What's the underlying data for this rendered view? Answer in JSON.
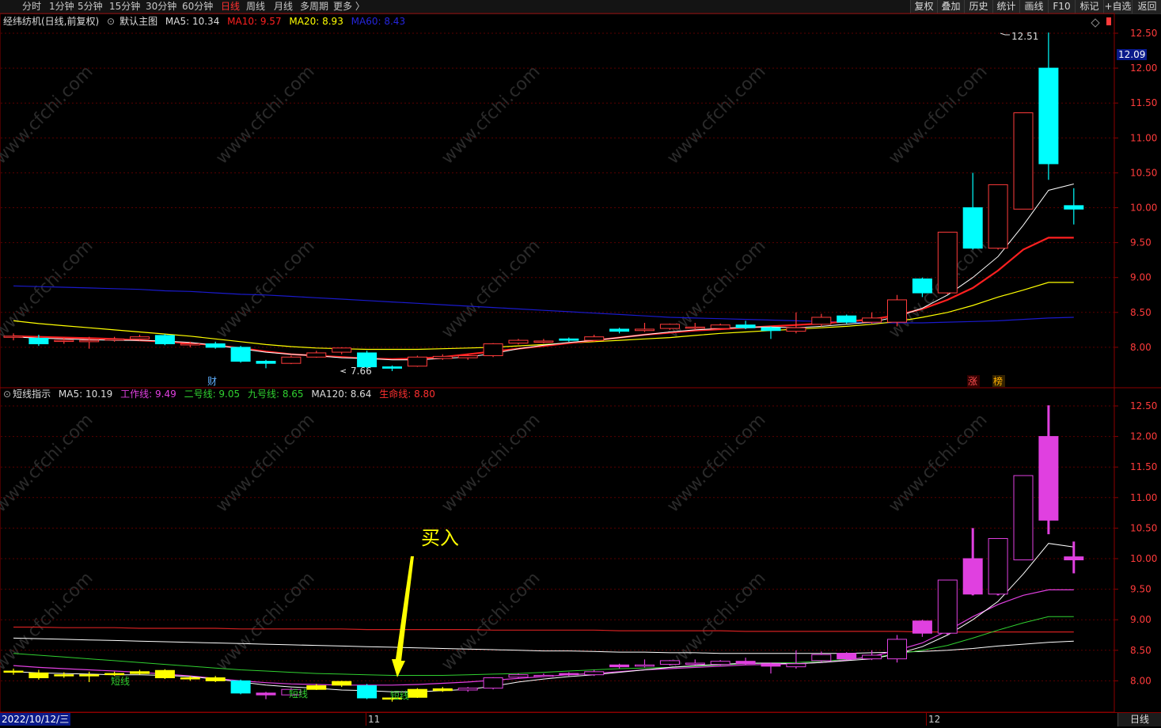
{
  "toolbar": {
    "periods": [
      "分时",
      "1分钟",
      "5分钟",
      "15分钟",
      "30分钟",
      "60分钟",
      "日线",
      "周线",
      "月线",
      "多周期",
      "更多 〉"
    ],
    "active_period": "日线",
    "buttons": [
      "复权",
      "叠加",
      "历史",
      "统计",
      "画线",
      "F10",
      "标记",
      "+自选",
      "返回"
    ]
  },
  "main_legend": {
    "stock": "经纬纺机(日线,前复权)",
    "template": "默认主图",
    "ma5": "MA5: 10.34",
    "ma10": "MA10: 9.57",
    "ma20": "MA20: 8.93",
    "ma60": "MA60: 8.43"
  },
  "sub_legend": {
    "indicator": "短线指示",
    "ma5": "MA5: 10.19",
    "work": "工作线: 9.49",
    "line2": "二号线: 9.05",
    "line9": "九号线: 8.65",
    "ma120": "MA120: 8.64",
    "life": "生命线: 8.80"
  },
  "price_axis": [
    "12.50",
    "12.00",
    "11.50",
    "11.00",
    "10.50",
    "10.00",
    "9.50",
    "9.00",
    "8.50",
    "8.00"
  ],
  "last_price": "12.09",
  "annotations": {
    "high": "12.51",
    "low": "7.66",
    "cai": "财",
    "zhang": "涨",
    "bang": "榜",
    "buy": "买入",
    "short_line": "短线"
  },
  "date_label": "2022/10/12/三",
  "month_ticks": [
    "11",
    "12"
  ],
  "period_button": "日线",
  "watermark": "www.cfchi.com",
  "colors": {
    "up": "#ff3b3b",
    "down": "#00ffff",
    "ma5": "#ffffff",
    "ma10": "#ff2020",
    "ma20": "#ffff00",
    "ma60": "#1a1acc",
    "work": "#e040e0",
    "line2": "#30d030",
    "line9": "#ffffff",
    "life": "#d02020",
    "buy_yellow": "#ffff00",
    "sub_up": "#e040e0"
  },
  "chart_data": [
    {
      "type": "candlestick",
      "title": "经纬纺机(日线,前复权)",
      "ylim": [
        7.5,
        12.6
      ],
      "candles": [
        {
          "o": 8.15,
          "c": 8.16,
          "h": 8.2,
          "l": 8.1
        },
        {
          "o": 8.13,
          "c": 8.05,
          "h": 8.18,
          "l": 8.02
        },
        {
          "o": 8.1,
          "c": 8.1,
          "h": 8.14,
          "l": 8.05
        },
        {
          "o": 8.08,
          "c": 8.1,
          "h": 8.15,
          "l": 7.98
        },
        {
          "o": 8.12,
          "c": 8.12,
          "h": 8.15,
          "l": 8.08
        },
        {
          "o": 8.12,
          "c": 8.15,
          "h": 8.18,
          "l": 8.1
        },
        {
          "o": 8.17,
          "c": 8.05,
          "h": 8.19,
          "l": 8.03
        },
        {
          "o": 8.05,
          "c": 8.05,
          "h": 8.08,
          "l": 8.0
        },
        {
          "o": 8.05,
          "c": 8.0,
          "h": 8.08,
          "l": 7.98
        },
        {
          "o": 8.0,
          "c": 7.8,
          "h": 8.02,
          "l": 7.78
        },
        {
          "o": 7.8,
          "c": 7.77,
          "h": 7.82,
          "l": 7.7
        },
        {
          "o": 7.77,
          "c": 7.86,
          "h": 7.88,
          "l": 7.76
        },
        {
          "o": 7.86,
          "c": 7.92,
          "h": 7.95,
          "l": 7.85
        },
        {
          "o": 7.93,
          "c": 7.99,
          "h": 8.0,
          "l": 7.9
        },
        {
          "o": 7.92,
          "c": 7.72,
          "h": 7.95,
          "l": 7.7
        },
        {
          "o": 7.72,
          "c": 7.7,
          "h": 7.74,
          "l": 7.66
        },
        {
          "o": 7.73,
          "c": 7.86,
          "h": 7.88,
          "l": 7.72
        },
        {
          "o": 7.84,
          "c": 7.87,
          "h": 7.9,
          "l": 7.82
        },
        {
          "o": 7.85,
          "c": 7.88,
          "h": 7.9,
          "l": 7.82
        },
        {
          "o": 7.88,
          "c": 8.05,
          "h": 8.06,
          "l": 7.86
        },
        {
          "o": 8.06,
          "c": 8.1,
          "h": 8.12,
          "l": 8.04
        },
        {
          "o": 8.08,
          "c": 8.09,
          "h": 8.12,
          "l": 8.06
        },
        {
          "o": 8.12,
          "c": 8.1,
          "h": 8.14,
          "l": 8.08
        },
        {
          "o": 8.1,
          "c": 8.15,
          "h": 8.18,
          "l": 8.08
        },
        {
          "o": 8.26,
          "c": 8.23,
          "h": 8.28,
          "l": 8.2
        },
        {
          "o": 8.24,
          "c": 8.26,
          "h": 8.35,
          "l": 8.22
        },
        {
          "o": 8.27,
          "c": 8.33,
          "h": 8.34,
          "l": 8.25
        },
        {
          "o": 8.28,
          "c": 8.29,
          "h": 8.35,
          "l": 8.25
        },
        {
          "o": 8.27,
          "c": 8.32,
          "h": 8.34,
          "l": 8.25
        },
        {
          "o": 8.32,
          "c": 8.28,
          "h": 8.38,
          "l": 8.26
        },
        {
          "o": 8.28,
          "c": 8.24,
          "h": 8.3,
          "l": 8.12
        },
        {
          "o": 8.23,
          "c": 8.28,
          "h": 8.5,
          "l": 8.2
        },
        {
          "o": 8.33,
          "c": 8.43,
          "h": 8.48,
          "l": 8.3
        },
        {
          "o": 8.45,
          "c": 8.36,
          "h": 8.47,
          "l": 8.34
        },
        {
          "o": 8.36,
          "c": 8.42,
          "h": 8.5,
          "l": 8.34
        },
        {
          "o": 8.36,
          "c": 8.68,
          "h": 8.75,
          "l": 8.3
        },
        {
          "o": 8.98,
          "c": 8.78,
          "h": 9.0,
          "l": 8.72
        },
        {
          "o": 8.78,
          "c": 9.65,
          "h": 9.65,
          "l": 8.76
        },
        {
          "o": 10.0,
          "c": 9.42,
          "h": 10.5,
          "l": 9.4
        },
        {
          "o": 9.42,
          "c": 10.33,
          "h": 10.33,
          "l": 9.4
        },
        {
          "o": 9.98,
          "c": 11.36,
          "h": 11.36,
          "l": 9.98
        },
        {
          "o": 12.0,
          "c": 10.63,
          "h": 12.51,
          "l": 10.4
        },
        {
          "o": 10.03,
          "c": 9.98,
          "h": 10.28,
          "l": 9.76
        }
      ],
      "ma5": [
        8.15,
        8.13,
        8.12,
        8.11,
        8.1,
        8.1,
        8.09,
        8.07,
        8.03,
        7.98,
        7.93,
        7.9,
        7.88,
        7.85,
        7.84,
        7.82,
        7.82,
        7.84,
        7.86,
        7.91,
        7.98,
        8.03,
        8.07,
        8.1,
        8.14,
        8.18,
        8.22,
        8.25,
        8.27,
        8.29,
        8.29,
        8.28,
        8.3,
        8.33,
        8.36,
        8.44,
        8.56,
        8.75,
        9.0,
        9.3,
        9.75,
        10.25,
        10.34
      ],
      "ma10": [
        8.16,
        8.15,
        8.14,
        8.13,
        8.12,
        8.1,
        8.08,
        8.06,
        8.03,
        7.99,
        7.94,
        7.9,
        7.88,
        7.86,
        7.84,
        7.83,
        7.84,
        7.86,
        7.9,
        7.94,
        7.98,
        8.02,
        8.06,
        8.1,
        8.14,
        8.18,
        8.21,
        8.24,
        8.26,
        8.28,
        8.3,
        8.32,
        8.34,
        8.37,
        8.4,
        8.46,
        8.55,
        8.68,
        8.85,
        9.1,
        9.4,
        9.57,
        9.57
      ],
      "ma20": [
        8.38,
        8.34,
        8.31,
        8.28,
        8.25,
        8.22,
        8.19,
        8.16,
        8.12,
        8.08,
        8.04,
        8.01,
        7.99,
        7.98,
        7.97,
        7.97,
        7.97,
        7.98,
        7.99,
        8.0,
        8.02,
        8.04,
        8.06,
        8.08,
        8.1,
        8.12,
        8.14,
        8.17,
        8.2,
        8.22,
        8.24,
        8.26,
        8.28,
        8.3,
        8.33,
        8.37,
        8.43,
        8.5,
        8.6,
        8.72,
        8.82,
        8.93,
        8.93
      ],
      "ma60": [
        8.88,
        8.87,
        8.86,
        8.85,
        8.84,
        8.83,
        8.81,
        8.8,
        8.78,
        8.76,
        8.75,
        8.73,
        8.71,
        8.69,
        8.67,
        8.65,
        8.63,
        8.61,
        8.59,
        8.57,
        8.55,
        8.53,
        8.51,
        8.49,
        8.47,
        8.45,
        8.43,
        8.42,
        8.41,
        8.4,
        8.39,
        8.38,
        8.37,
        8.36,
        8.35,
        8.35,
        8.35,
        8.36,
        8.37,
        8.38,
        8.4,
        8.42,
        8.43
      ]
    },
    {
      "type": "candlestick",
      "title": "短线指示",
      "ylim": [
        7.5,
        12.6
      ],
      "yellow_candles": [
        0,
        1,
        2,
        3,
        4,
        5,
        6,
        7,
        8,
        9,
        12,
        13,
        14,
        15,
        16,
        17
      ],
      "ma5": [
        8.15,
        8.13,
        8.12,
        8.11,
        8.1,
        8.1,
        8.09,
        8.07,
        8.03,
        7.98,
        7.93,
        7.9,
        7.88,
        7.85,
        7.84,
        7.82,
        7.82,
        7.84,
        7.86,
        7.91,
        7.98,
        8.03,
        8.07,
        8.1,
        8.14,
        8.18,
        8.22,
        8.25,
        8.27,
        8.29,
        8.29,
        8.28,
        8.3,
        8.33,
        8.36,
        8.44,
        8.56,
        8.75,
        9.0,
        9.3,
        9.75,
        10.25,
        10.19
      ],
      "work": [
        8.25,
        8.22,
        8.2,
        8.18,
        8.16,
        8.14,
        8.11,
        8.08,
        8.04,
        8.0,
        7.97,
        7.95,
        7.94,
        7.93,
        7.93,
        7.93,
        7.94,
        7.96,
        7.98,
        8.01,
        8.04,
        8.07,
        8.1,
        8.12,
        8.15,
        8.18,
        8.2,
        8.22,
        8.24,
        8.26,
        8.27,
        8.28,
        8.3,
        8.34,
        8.4,
        8.5,
        8.62,
        8.82,
        9.05,
        9.25,
        9.4,
        9.49,
        9.49
      ],
      "line2": [
        8.45,
        8.42,
        8.39,
        8.36,
        8.33,
        8.3,
        8.27,
        8.24,
        8.21,
        8.18,
        8.16,
        8.14,
        8.12,
        8.11,
        8.1,
        8.09,
        8.09,
        8.09,
        8.1,
        8.11,
        8.12,
        8.14,
        8.16,
        8.18,
        8.2,
        8.21,
        8.22,
        8.24,
        8.26,
        8.28,
        8.29,
        8.3,
        8.32,
        8.35,
        8.38,
        8.44,
        8.5,
        8.58,
        8.7,
        8.83,
        8.95,
        9.05,
        9.05
      ],
      "line9": [
        8.7,
        8.69,
        8.68,
        8.67,
        8.66,
        8.65,
        8.64,
        8.63,
        8.62,
        8.61,
        8.6,
        8.59,
        8.58,
        8.57,
        8.56,
        8.55,
        8.54,
        8.53,
        8.52,
        8.51,
        8.5,
        8.49,
        8.49,
        8.48,
        8.47,
        8.47,
        8.46,
        8.46,
        8.45,
        8.45,
        8.45,
        8.45,
        8.45,
        8.45,
        8.46,
        8.47,
        8.48,
        8.5,
        8.53,
        8.57,
        8.6,
        8.63,
        8.65
      ],
      "life": [
        8.88,
        8.88,
        8.87,
        8.87,
        8.87,
        8.86,
        8.86,
        8.86,
        8.86,
        8.85,
        8.85,
        8.85,
        8.85,
        8.85,
        8.84,
        8.84,
        8.84,
        8.84,
        8.84,
        8.83,
        8.83,
        8.83,
        8.83,
        8.83,
        8.82,
        8.82,
        8.82,
        8.82,
        8.82,
        8.81,
        8.81,
        8.81,
        8.81,
        8.81,
        8.81,
        8.81,
        8.8,
        8.8,
        8.8,
        8.8,
        8.8,
        8.8,
        8.8
      ]
    }
  ]
}
